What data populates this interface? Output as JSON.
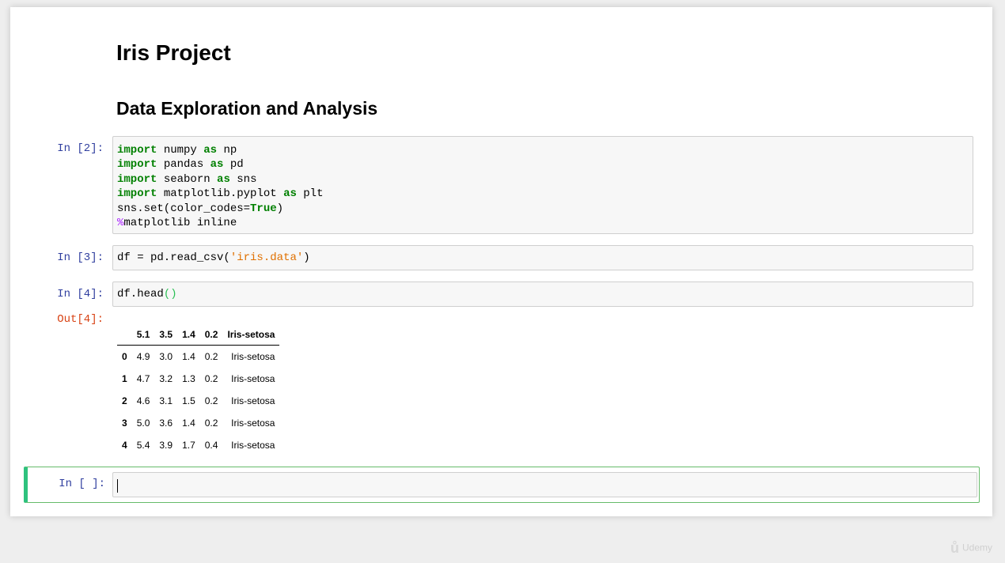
{
  "markdown": {
    "title": "Iris Project",
    "subtitle": "Data Exploration and Analysis"
  },
  "cells": {
    "c2": {
      "prompt": "In [2]:",
      "lines": [
        {
          "kw": "import",
          "mid": " numpy ",
          "kw2": "as",
          "end": " np"
        },
        {
          "kw": "import",
          "mid": " pandas ",
          "kw2": "as",
          "end": " pd"
        },
        {
          "kw": "import",
          "mid": " seaborn ",
          "kw2": "as",
          "end": " sns"
        },
        {
          "kw": "import",
          "mid": " matplotlib.pyplot ",
          "kw2": "as",
          "end": " plt"
        }
      ],
      "line5_pre": "sns.set(color_codes=",
      "line5_bool": "True",
      "line5_post": ")",
      "line6_mag": "%",
      "line6_rest": "matplotlib inline"
    },
    "c3": {
      "prompt": "In [3]:",
      "pre": "df = pd.read_csv(",
      "str": "'iris.data'",
      "post": ")"
    },
    "c4": {
      "prompt": "In [4]:",
      "pre": "df.head",
      "paren": "()"
    },
    "out4": {
      "prompt": "Out[4]:",
      "columns": [
        "",
        "5.1",
        "3.5",
        "1.4",
        "0.2",
        "Iris-setosa"
      ],
      "rows": [
        [
          "0",
          "4.9",
          "3.0",
          "1.4",
          "0.2",
          "Iris-setosa"
        ],
        [
          "1",
          "4.7",
          "3.2",
          "1.3",
          "0.2",
          "Iris-setosa"
        ],
        [
          "2",
          "4.6",
          "3.1",
          "1.5",
          "0.2",
          "Iris-setosa"
        ],
        [
          "3",
          "5.0",
          "3.6",
          "1.4",
          "0.2",
          "Iris-setosa"
        ],
        [
          "4",
          "5.4",
          "3.9",
          "1.7",
          "0.4",
          "Iris-setosa"
        ]
      ]
    },
    "c5": {
      "prompt": "In [ ]:"
    }
  },
  "watermark": {
    "logo": "ů",
    "text": "Udemy"
  }
}
